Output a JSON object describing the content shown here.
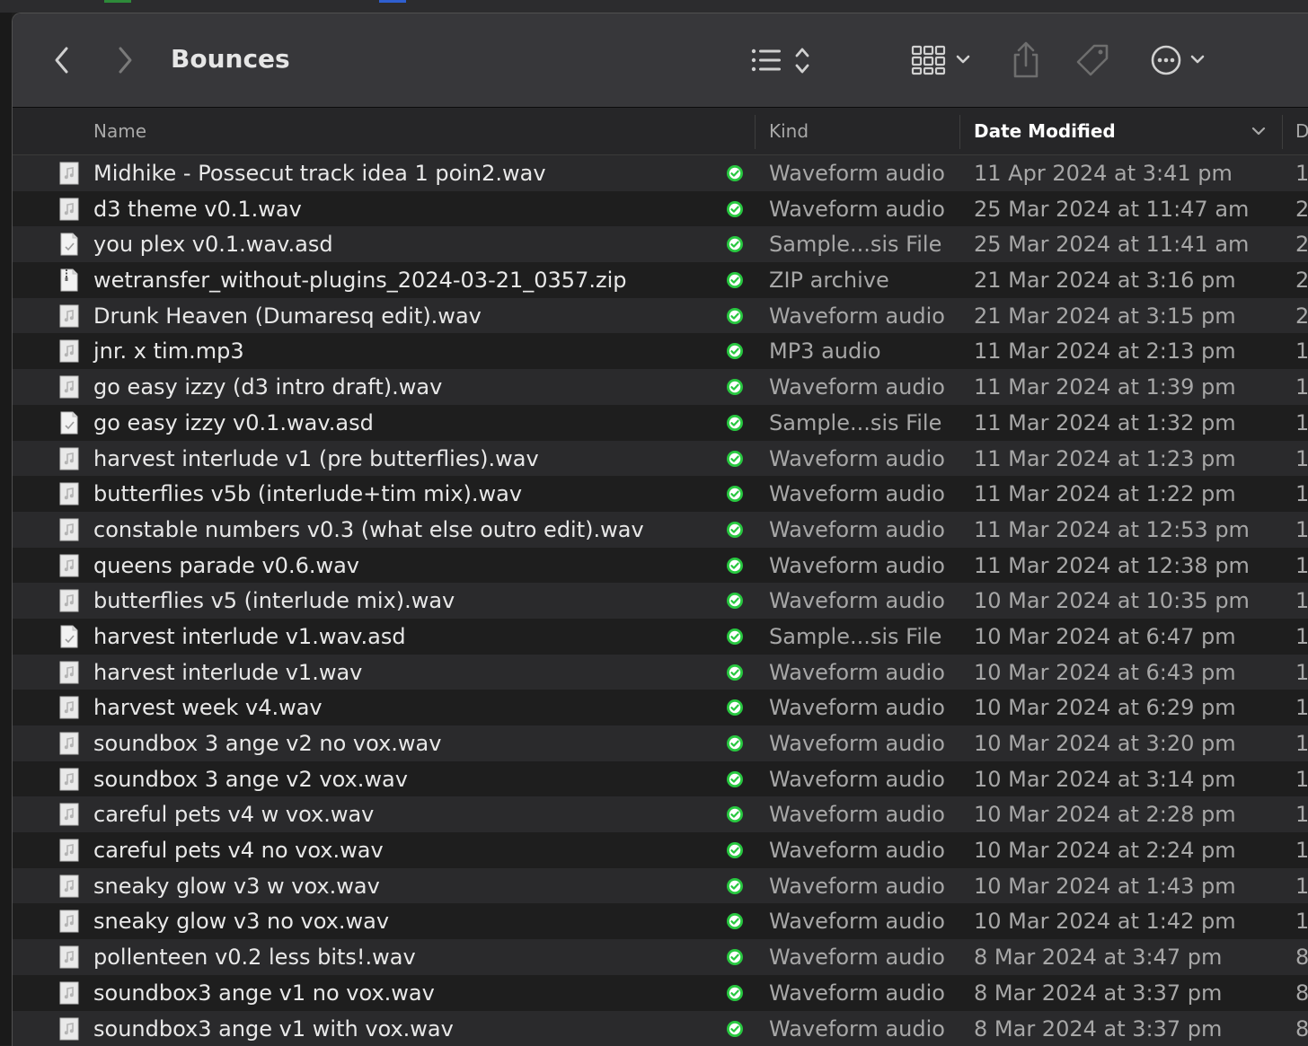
{
  "window": {
    "title": "Bounces"
  },
  "toolbar": {
    "back_icon": "chevron-left-icon",
    "forward_icon": "chevron-right-icon",
    "view_icon": "list-view-icon",
    "group_icon": "grid-group-icon",
    "share_icon": "share-icon",
    "tag_icon": "tag-icon",
    "more_icon": "ellipsis-circle-icon"
  },
  "columns": {
    "name": "Name",
    "kind": "Kind",
    "date_modified": "Date Modified",
    "next_truncated": "D"
  },
  "colors": {
    "toolbar_bg": "#37373a",
    "row_alt": "#2a2a2c",
    "row_base": "#1e1e1e",
    "sync_green": "#28c840"
  },
  "files": [
    {
      "name": "Midhike - Possecut track idea 1 poin2.wav",
      "kind": "Waveform audio",
      "date": "11 Apr 2024 at 3:41 pm",
      "extra": "1",
      "icon": "audio-file-icon"
    },
    {
      "name": "d3 theme v0.1.wav",
      "kind": "Waveform audio",
      "date": "25 Mar 2024 at 11:47 am",
      "extra": "2",
      "icon": "audio-file-icon"
    },
    {
      "name": "you plex v0.1.wav.asd",
      "kind": "Sample...sis File",
      "date": "25 Mar 2024 at 11:41 am",
      "extra": "2",
      "icon": "document-icon"
    },
    {
      "name": "wetransfer_without-plugins_2024-03-21_0357.zip",
      "kind": "ZIP archive",
      "date": "21 Mar 2024 at 3:16 pm",
      "extra": "2",
      "icon": "zip-file-icon"
    },
    {
      "name": "Drunk Heaven (Dumaresq edit).wav",
      "kind": "Waveform audio",
      "date": "21 Mar 2024 at 3:15 pm",
      "extra": "2",
      "icon": "audio-file-icon"
    },
    {
      "name": "jnr. x tim.mp3",
      "kind": "MP3 audio",
      "date": "11 Mar 2024 at 2:13 pm",
      "extra": "1",
      "icon": "audio-file-icon"
    },
    {
      "name": "go easy izzy (d3 intro draft).wav",
      "kind": "Waveform audio",
      "date": "11 Mar 2024 at 1:39 pm",
      "extra": "1",
      "icon": "audio-file-icon"
    },
    {
      "name": "go easy izzy v0.1.wav.asd",
      "kind": "Sample...sis File",
      "date": "11 Mar 2024 at 1:32 pm",
      "extra": "1",
      "icon": "document-icon"
    },
    {
      "name": "harvest interlude v1 (pre butterflies).wav",
      "kind": "Waveform audio",
      "date": "11 Mar 2024 at 1:23 pm",
      "extra": "1",
      "icon": "audio-file-icon"
    },
    {
      "name": "butterflies v5b (interlude+tim mix).wav",
      "kind": "Waveform audio",
      "date": "11 Mar 2024 at 1:22 pm",
      "extra": "1",
      "icon": "audio-file-icon"
    },
    {
      "name": "constable numbers v0.3 (what else outro edit).wav",
      "kind": "Waveform audio",
      "date": "11 Mar 2024 at 12:53 pm",
      "extra": "1",
      "icon": "audio-file-icon"
    },
    {
      "name": "queens parade v0.6.wav",
      "kind": "Waveform audio",
      "date": "11 Mar 2024 at 12:38 pm",
      "extra": "1",
      "icon": "audio-file-icon"
    },
    {
      "name": "butterflies v5 (interlude mix).wav",
      "kind": "Waveform audio",
      "date": "10 Mar 2024 at 10:35 pm",
      "extra": "1",
      "icon": "audio-file-icon"
    },
    {
      "name": "harvest interlude v1.wav.asd",
      "kind": "Sample...sis File",
      "date": "10 Mar 2024 at 6:47 pm",
      "extra": "1",
      "icon": "document-icon"
    },
    {
      "name": "harvest interlude v1.wav",
      "kind": "Waveform audio",
      "date": "10 Mar 2024 at 6:43 pm",
      "extra": "1",
      "icon": "audio-file-icon"
    },
    {
      "name": "harvest week v4.wav",
      "kind": "Waveform audio",
      "date": "10 Mar 2024 at 6:29 pm",
      "extra": "1",
      "icon": "audio-file-icon"
    },
    {
      "name": "soundbox 3 ange v2 no vox.wav",
      "kind": "Waveform audio",
      "date": "10 Mar 2024 at 3:20 pm",
      "extra": "1",
      "icon": "audio-file-icon"
    },
    {
      "name": "soundbox 3 ange v2 vox.wav",
      "kind": "Waveform audio",
      "date": "10 Mar 2024 at 3:14 pm",
      "extra": "1",
      "icon": "audio-file-icon"
    },
    {
      "name": "careful pets v4 w vox.wav",
      "kind": "Waveform audio",
      "date": "10 Mar 2024 at 2:28 pm",
      "extra": "1",
      "icon": "audio-file-icon"
    },
    {
      "name": "careful pets v4 no vox.wav",
      "kind": "Waveform audio",
      "date": "10 Mar 2024 at 2:24 pm",
      "extra": "1",
      "icon": "audio-file-icon"
    },
    {
      "name": "sneaky glow v3 w vox.wav",
      "kind": "Waveform audio",
      "date": "10 Mar 2024 at 1:43 pm",
      "extra": "1",
      "icon": "audio-file-icon"
    },
    {
      "name": "sneaky glow v3 no vox.wav",
      "kind": "Waveform audio",
      "date": "10 Mar 2024 at 1:42 pm",
      "extra": "1",
      "icon": "audio-file-icon"
    },
    {
      "name": "pollenteen v0.2 less bits!.wav",
      "kind": "Waveform audio",
      "date": "8 Mar 2024 at 3:47 pm",
      "extra": "8",
      "icon": "audio-file-icon"
    },
    {
      "name": "soundbox3 ange v1 no vox.wav",
      "kind": "Waveform audio",
      "date": "8 Mar 2024 at 3:37 pm",
      "extra": "8",
      "icon": "audio-file-icon"
    },
    {
      "name": "soundbox3 ange v1 with vox.wav",
      "kind": "Waveform audio",
      "date": "8 Mar 2024 at 3:37 pm",
      "extra": "8",
      "icon": "audio-file-icon"
    }
  ]
}
